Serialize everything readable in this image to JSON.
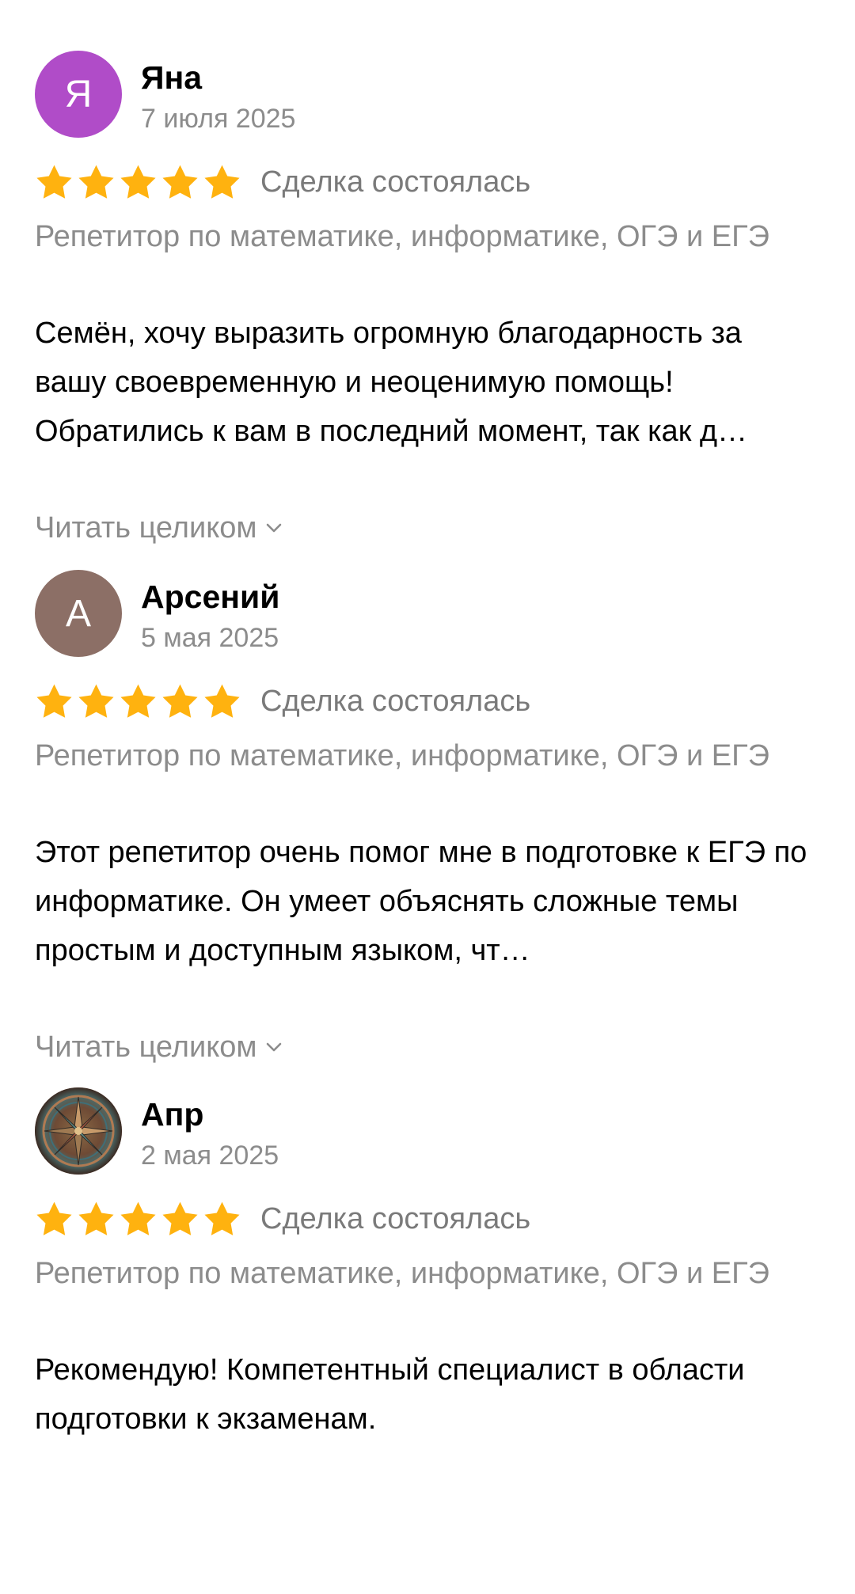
{
  "reviews": [
    {
      "avatar_letter": "Я",
      "avatar_color": "#b04cc8",
      "name": "Яна",
      "date": "7 июля 2025",
      "rating": 5,
      "deal_status": "Сделка состоялась",
      "service": "Репетитор по математике, информатике, ОГЭ и ЕГЭ",
      "text": "Семён, хочу выразить огромную благодарность за вашу своевременную и неоценимую помощь! Обратились к вам в последний момент, так как д…",
      "read_more": "Читать целиком"
    },
    {
      "avatar_letter": "А",
      "avatar_color": "#8c6f66",
      "name": "Арсений",
      "date": "5 мая 2025",
      "rating": 5,
      "deal_status": "Сделка состоялась",
      "service": "Репетитор по математике, информатике, ОГЭ и ЕГЭ",
      "text": "Этот репетитор очень помог мне в подготовке к ЕГЭ по информатике. Он умеет объяснять сложные темы простым и доступным языком, чт…",
      "read_more": "Читать целиком"
    },
    {
      "avatar_icon": "compass-rose-photo-avatar",
      "name": "Апр",
      "date": "2 мая 2025",
      "rating": 5,
      "deal_status": "Сделка состоялась",
      "service": "Репетитор по математике, информатике, ОГЭ и ЕГЭ",
      "text": "Рекомендую! Компетентный специалист в области подготовки к экзаменам."
    }
  ],
  "colors": {
    "star": "#ffb20f",
    "secondary_text": "#8c8c8c"
  }
}
